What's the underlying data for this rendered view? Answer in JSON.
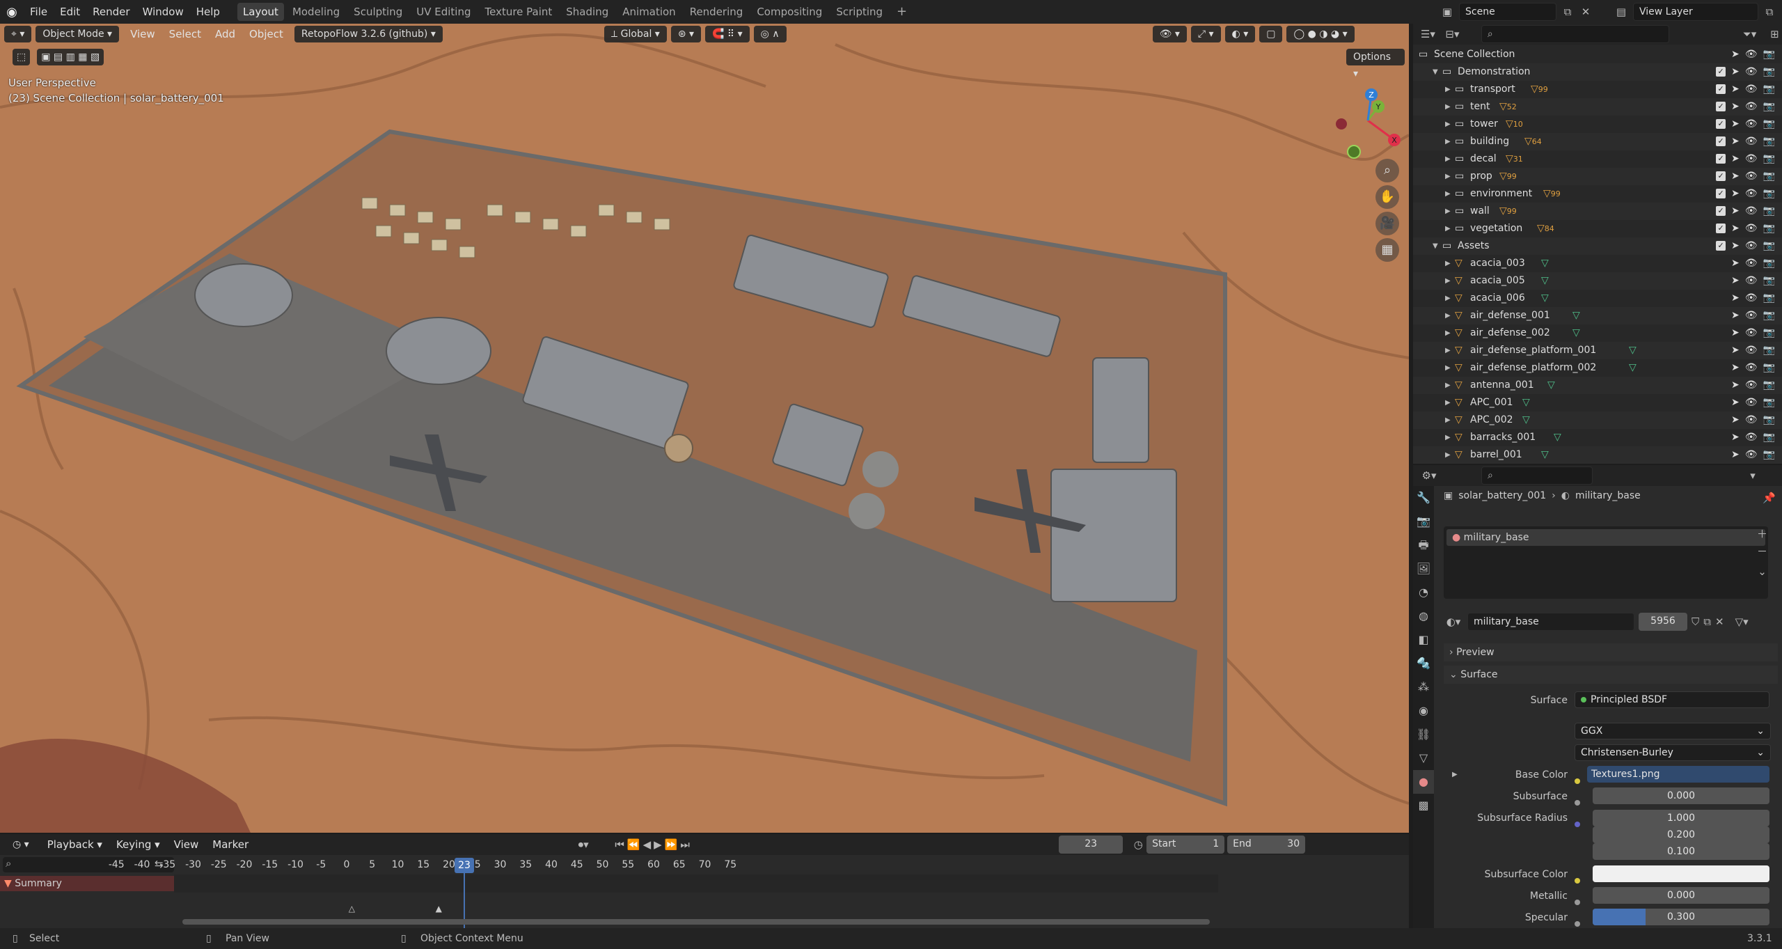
{
  "topbar": {
    "menus": [
      "File",
      "Edit",
      "Render",
      "Window",
      "Help"
    ],
    "workspaces": [
      "Layout",
      "Modeling",
      "Sculpting",
      "UV Editing",
      "Texture Paint",
      "Shading",
      "Animation",
      "Rendering",
      "Compositing",
      "Scripting"
    ],
    "active_workspace": "Layout",
    "add_tab": "+",
    "scene_name": "Scene",
    "view_layer": "View Layer"
  },
  "viewport": {
    "mode": "Object Mode",
    "menus": [
      "View",
      "Select",
      "Add",
      "Object"
    ],
    "addon": "RetopoFlow 3.2.6 (github)",
    "orientation": "Global",
    "options_label": "Options",
    "overlay_title": "User Perspective",
    "overlay_sub": "(23) Scene Collection | solar_battery_001",
    "gizmo": {
      "x": "X",
      "y": "Y",
      "z": "Z"
    }
  },
  "outliner": {
    "root": "Scene Collection",
    "collections": [
      {
        "name": "Demonstration",
        "children": [
          {
            "name": "transport",
            "badge": "99"
          },
          {
            "name": "tent",
            "badge": "52"
          },
          {
            "name": "tower",
            "badge": "10"
          },
          {
            "name": "building",
            "badge": "64"
          },
          {
            "name": "decal",
            "badge": "31"
          },
          {
            "name": "prop",
            "badge": "99"
          },
          {
            "name": "environment",
            "badge": "99"
          },
          {
            "name": "wall",
            "badge": "99"
          },
          {
            "name": "vegetation",
            "badge": "84"
          }
        ]
      },
      {
        "name": "Assets",
        "children": [
          {
            "name": "acacia_003"
          },
          {
            "name": "acacia_005"
          },
          {
            "name": "acacia_006"
          },
          {
            "name": "air_defense_001"
          },
          {
            "name": "air_defense_002"
          },
          {
            "name": "air_defense_platform_001"
          },
          {
            "name": "air_defense_platform_002"
          },
          {
            "name": "antenna_001"
          },
          {
            "name": "APC_001"
          },
          {
            "name": "APC_002"
          },
          {
            "name": "barracks_001"
          },
          {
            "name": "barrel_001"
          }
        ]
      }
    ]
  },
  "properties": {
    "breadcrumb_object": "solar_battery_001",
    "breadcrumb_material": "military_base",
    "slot_name": "military_base",
    "material_name": "military_base",
    "users": "5956",
    "sections": {
      "preview": "Preview",
      "surface": "Surface"
    },
    "surface_label": "Surface",
    "surface_shader": "Principled BSDF",
    "distribution": "GGX",
    "subsurface_method": "Christensen-Burley",
    "fields": {
      "base_color_label": "Base Color",
      "base_color_value": "Textures1.png",
      "subsurface_label": "Subsurface",
      "subsurface_value": "0.000",
      "subsurface_radius_label": "Subsurface Radius",
      "radius_values": [
        "1.000",
        "0.200",
        "0.100"
      ],
      "subsurface_color_label": "Subsurface Color",
      "metallic_label": "Metallic",
      "metallic_value": "0.000",
      "specular_label": "Specular",
      "specular_value": "0.300",
      "specular_fraction": 0.3
    }
  },
  "timeline": {
    "menus": [
      "Playback",
      "Keying",
      "View",
      "Marker"
    ],
    "current_frame": "23",
    "start_label": "Start",
    "start": "1",
    "end_label": "End",
    "end": "30",
    "ticks": [
      "-45",
      "-40",
      "-35",
      "-30",
      "-25",
      "-20",
      "-15",
      "-10",
      "-5",
      "0",
      "5",
      "10",
      "15",
      "20",
      "25",
      "30",
      "35",
      "40",
      "45",
      "50",
      "55",
      "60",
      "65",
      "70",
      "75"
    ],
    "summary": "Summary"
  },
  "statusbar": {
    "select": "Select",
    "pan": "Pan View",
    "context": "Object Context Menu",
    "version": "3.3.1"
  },
  "colors": {
    "accent": "#4772b3",
    "viewport_ground": "#b77c54",
    "x_axis": "#e0304a",
    "y_axis": "#7ab33a",
    "z_axis": "#2f7fd6"
  }
}
